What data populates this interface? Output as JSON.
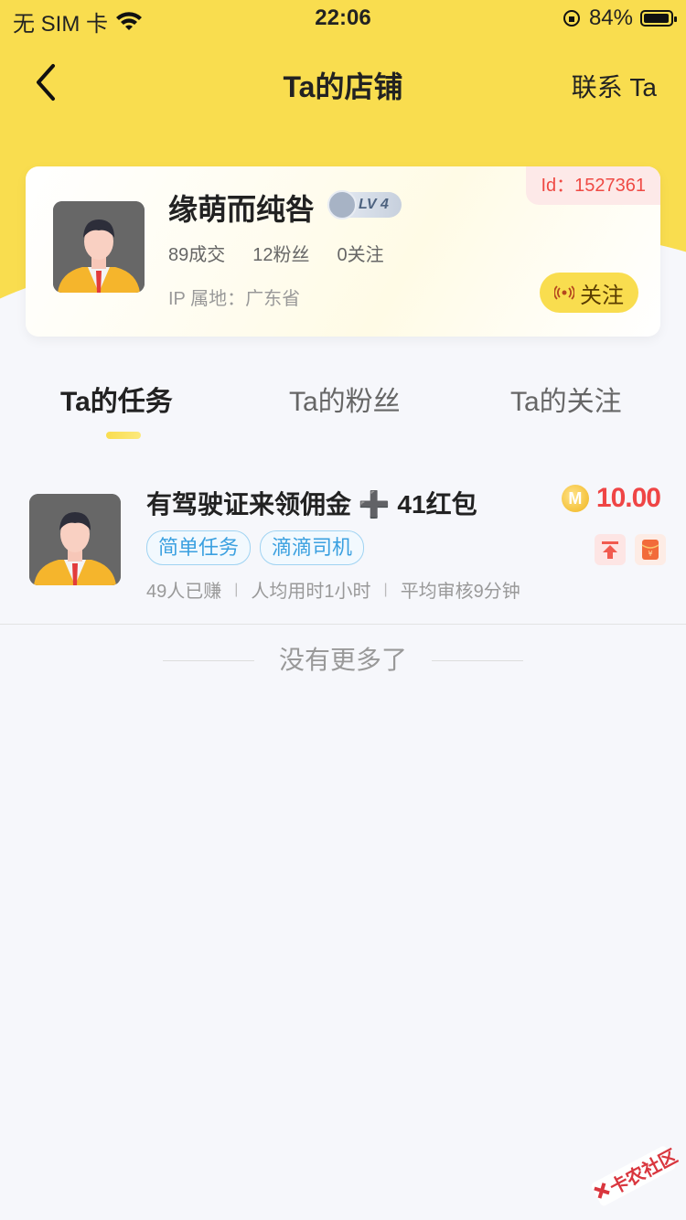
{
  "status_bar": {
    "carrier": "无 SIM 卡",
    "time": "22:06",
    "battery_percent": "84%",
    "battery_level": 0.84
  },
  "nav": {
    "title": "Ta的店铺",
    "contact_label": "联系 Ta"
  },
  "profile": {
    "name": "缘萌而纯咎",
    "level": "LV 4",
    "id_label": "Id：1527361",
    "stats": [
      "89成交",
      "12粉丝",
      "0关注"
    ],
    "ip": "IP 属地：广东省",
    "follow_label": "关注"
  },
  "tabs": [
    {
      "label": "Ta的任务",
      "active": true
    },
    {
      "label": "Ta的粉丝",
      "active": false
    },
    {
      "label": "Ta的关注",
      "active": false
    }
  ],
  "task": {
    "title": "有驾驶证来领佣金 ➕ 41红包",
    "price": "10.00",
    "coin_label": "M",
    "tags": [
      "简单任务",
      "滴滴司机"
    ],
    "meta": [
      "49人已赚",
      "人均用时1小时",
      "平均审核9分钟"
    ]
  },
  "footer": {
    "no_more": "没有更多了"
  },
  "watermark": {
    "text": "卡农社区"
  }
}
